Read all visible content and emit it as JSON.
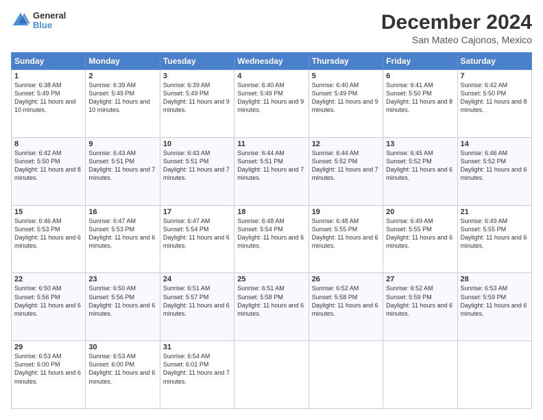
{
  "header": {
    "logo_line1": "General",
    "logo_line2": "Blue",
    "title": "December 2024",
    "subtitle": "San Mateo Cajonos, Mexico"
  },
  "days_of_week": [
    "Sunday",
    "Monday",
    "Tuesday",
    "Wednesday",
    "Thursday",
    "Friday",
    "Saturday"
  ],
  "weeks": [
    [
      {
        "day": "1",
        "sunrise": "6:38 AM",
        "sunset": "5:49 PM",
        "daylight": "11 hours and 10 minutes."
      },
      {
        "day": "2",
        "sunrise": "6:39 AM",
        "sunset": "5:49 PM",
        "daylight": "11 hours and 10 minutes."
      },
      {
        "day": "3",
        "sunrise": "6:39 AM",
        "sunset": "5:49 PM",
        "daylight": "11 hours and 9 minutes."
      },
      {
        "day": "4",
        "sunrise": "6:40 AM",
        "sunset": "5:49 PM",
        "daylight": "11 hours and 9 minutes."
      },
      {
        "day": "5",
        "sunrise": "6:40 AM",
        "sunset": "5:49 PM",
        "daylight": "11 hours and 9 minutes."
      },
      {
        "day": "6",
        "sunrise": "6:41 AM",
        "sunset": "5:50 PM",
        "daylight": "11 hours and 8 minutes."
      },
      {
        "day": "7",
        "sunrise": "6:42 AM",
        "sunset": "5:50 PM",
        "daylight": "11 hours and 8 minutes."
      }
    ],
    [
      {
        "day": "8",
        "sunrise": "6:42 AM",
        "sunset": "5:50 PM",
        "daylight": "11 hours and 8 minutes."
      },
      {
        "day": "9",
        "sunrise": "6:43 AM",
        "sunset": "5:51 PM",
        "daylight": "11 hours and 7 minutes."
      },
      {
        "day": "10",
        "sunrise": "6:43 AM",
        "sunset": "5:51 PM",
        "daylight": "11 hours and 7 minutes."
      },
      {
        "day": "11",
        "sunrise": "6:44 AM",
        "sunset": "5:51 PM",
        "daylight": "11 hours and 7 minutes."
      },
      {
        "day": "12",
        "sunrise": "6:44 AM",
        "sunset": "5:52 PM",
        "daylight": "11 hours and 7 minutes."
      },
      {
        "day": "13",
        "sunrise": "6:45 AM",
        "sunset": "5:52 PM",
        "daylight": "11 hours and 6 minutes."
      },
      {
        "day": "14",
        "sunrise": "6:46 AM",
        "sunset": "5:52 PM",
        "daylight": "11 hours and 6 minutes."
      }
    ],
    [
      {
        "day": "15",
        "sunrise": "6:46 AM",
        "sunset": "5:53 PM",
        "daylight": "11 hours and 6 minutes."
      },
      {
        "day": "16",
        "sunrise": "6:47 AM",
        "sunset": "5:53 PM",
        "daylight": "11 hours and 6 minutes."
      },
      {
        "day": "17",
        "sunrise": "6:47 AM",
        "sunset": "5:54 PM",
        "daylight": "11 hours and 6 minutes."
      },
      {
        "day": "18",
        "sunrise": "6:48 AM",
        "sunset": "5:54 PM",
        "daylight": "11 hours and 6 minutes."
      },
      {
        "day": "19",
        "sunrise": "6:48 AM",
        "sunset": "5:55 PM",
        "daylight": "11 hours and 6 minutes."
      },
      {
        "day": "20",
        "sunrise": "6:49 AM",
        "sunset": "5:55 PM",
        "daylight": "11 hours and 6 minutes."
      },
      {
        "day": "21",
        "sunrise": "6:49 AM",
        "sunset": "5:55 PM",
        "daylight": "11 hours and 6 minutes."
      }
    ],
    [
      {
        "day": "22",
        "sunrise": "6:50 AM",
        "sunset": "5:56 PM",
        "daylight": "11 hours and 6 minutes."
      },
      {
        "day": "23",
        "sunrise": "6:50 AM",
        "sunset": "5:56 PM",
        "daylight": "11 hours and 6 minutes."
      },
      {
        "day": "24",
        "sunrise": "6:51 AM",
        "sunset": "5:57 PM",
        "daylight": "11 hours and 6 minutes."
      },
      {
        "day": "25",
        "sunrise": "6:51 AM",
        "sunset": "5:58 PM",
        "daylight": "11 hours and 6 minutes."
      },
      {
        "day": "26",
        "sunrise": "6:52 AM",
        "sunset": "5:58 PM",
        "daylight": "11 hours and 6 minutes."
      },
      {
        "day": "27",
        "sunrise": "6:52 AM",
        "sunset": "5:59 PM",
        "daylight": "11 hours and 6 minutes."
      },
      {
        "day": "28",
        "sunrise": "6:53 AM",
        "sunset": "5:59 PM",
        "daylight": "11 hours and 6 minutes."
      }
    ],
    [
      {
        "day": "29",
        "sunrise": "6:53 AM",
        "sunset": "6:00 PM",
        "daylight": "11 hours and 6 minutes."
      },
      {
        "day": "30",
        "sunrise": "6:53 AM",
        "sunset": "6:00 PM",
        "daylight": "11 hours and 6 minutes."
      },
      {
        "day": "31",
        "sunrise": "6:54 AM",
        "sunset": "6:01 PM",
        "daylight": "11 hours and 7 minutes."
      },
      null,
      null,
      null,
      null
    ]
  ],
  "labels": {
    "sunrise": "Sunrise:",
    "sunset": "Sunset:",
    "daylight": "Daylight:"
  }
}
